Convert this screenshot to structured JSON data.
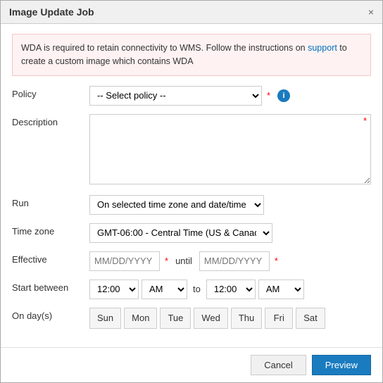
{
  "dialog": {
    "title": "Image Update Job",
    "close_label": "×"
  },
  "alert": {
    "message_part1": "WDA is required to retain connectivity to WMS. Follow the instructions on ",
    "link_text": "support",
    "message_part2": " to create a custom image which contains WDA"
  },
  "form": {
    "policy_label": "Policy",
    "policy_placeholder": "-- Select policy --",
    "description_label": "Description",
    "run_label": "Run",
    "run_option": "On selected time zone and date/time",
    "timezone_label": "Time zone",
    "timezone_option": "GMT-06:00 - Central Time (US & Canad.",
    "effective_label": "Effective",
    "date_placeholder": "MM/DD/YYYY",
    "until_label": "until",
    "start_between_label": "Start between",
    "time_start": "12:00",
    "ampm_start": "AM",
    "to_label": "to",
    "time_end": "12:00",
    "ampm_end": "AM",
    "on_days_label": "On day(s)",
    "days": [
      "Sun",
      "Mon",
      "Tue",
      "Wed",
      "Thu",
      "Fri",
      "Sat"
    ]
  },
  "footer": {
    "cancel_label": "Cancel",
    "preview_label": "Preview"
  }
}
